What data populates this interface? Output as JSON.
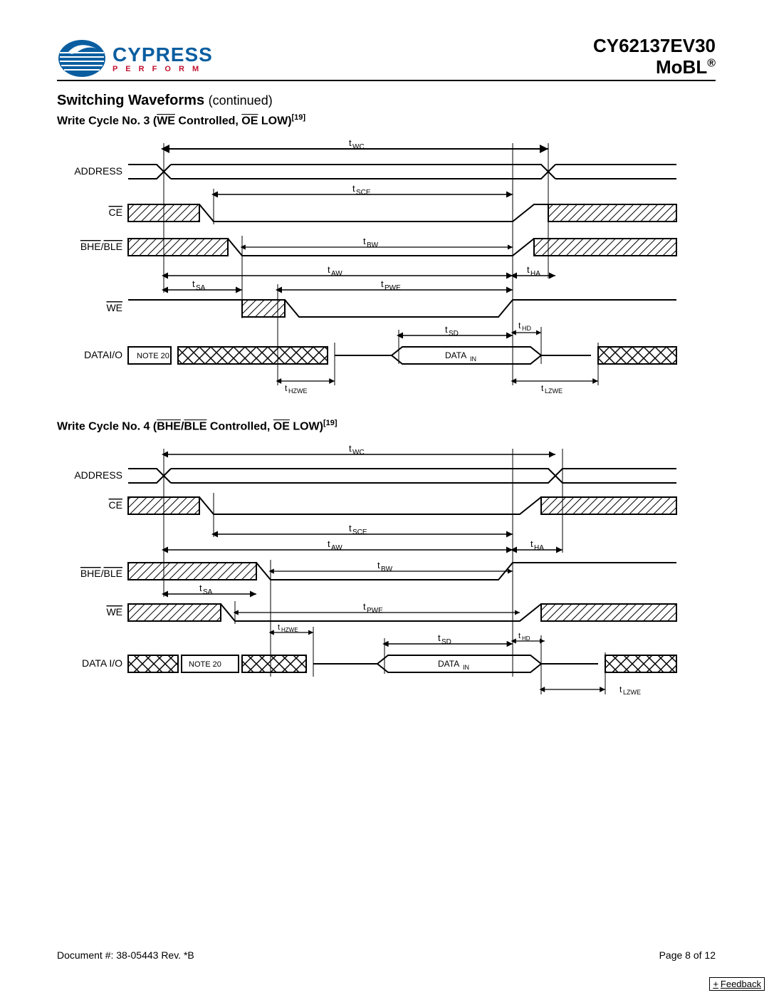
{
  "header": {
    "brand_main": "CYPRESS",
    "brand_sub": "P E R F O R M",
    "part_line1": "CY62137EV30",
    "part_line2": "MoBL"
  },
  "section": {
    "title": "Switching Waveforms",
    "continued": "(continued)"
  },
  "wf3": {
    "title_pre": "Write Cycle No. 3 (",
    "we": "WE",
    "mid": " Controlled, ",
    "oe": "OE",
    "post": " LOW)",
    "note_ref": "[19]",
    "signals": {
      "address": "ADDRESS",
      "ce": "CE",
      "bhe_ble_a": "BHE",
      "bhe_ble_b": "BLE",
      "we": "WE",
      "dataio": "DATAI/O"
    },
    "labels": {
      "twc": "tWC",
      "tsce": "tSCE",
      "tbw": "tBW",
      "taw": "tAW",
      "tha": "tHA",
      "tsa": "tSA",
      "tpwe": "tPWE",
      "tsd": "tSD",
      "thd": "tHD",
      "thzwe": "tHZWE",
      "tlzwe": "tLZWE",
      "note20": "NOTE 20",
      "datain": "DATAIN"
    }
  },
  "wf4": {
    "title_pre": "Write Cycle No. 4 (",
    "bhe": "BHE",
    "slash": "/",
    "ble": "BLE",
    "mid": " Controlled, ",
    "oe": "OE",
    "post": " LOW)",
    "note_ref": "[19]",
    "signals": {
      "address": "ADDRESS",
      "ce": "CE",
      "bhe_ble_a": "BHE",
      "bhe_ble_b": "BLE",
      "we": "WE",
      "dataio": "DATA I/O"
    },
    "labels": {
      "twc": "tWC",
      "tsce": "tSCE",
      "tbw": "tBW",
      "taw": "tAW",
      "tha": "tHA",
      "tsa": "tSA",
      "tpwe": "tPWE",
      "tsd": "tSD",
      "thd": "tHD",
      "thzwe": "tHZWE",
      "tlzwe": "tLZWE",
      "note20": "NOTE 20",
      "datain": "DATAIN"
    }
  },
  "footer": {
    "doc": "Document #: 38-05443 Rev. *B",
    "page": "Page 8 of 12",
    "feedback": "Feedback",
    "feedback_icon": "+"
  },
  "chart_data": [
    {
      "type": "timing-diagram",
      "title": "Write Cycle No. 3 (WE Controlled, OE LOW)",
      "note_ref": 19,
      "signals": [
        "ADDRESS",
        "CE",
        "BHE/BLE",
        "WE",
        "DATA I/O"
      ],
      "intervals": [
        {
          "name": "tWC",
          "from": "ADDRESS valid start",
          "to": "ADDRESS valid end"
        },
        {
          "name": "tSCE",
          "from": "CE low",
          "to": "WE high"
        },
        {
          "name": "tBW",
          "from": "BHE/BLE low",
          "to": "WE high"
        },
        {
          "name": "tAW",
          "from": "ADDRESS valid",
          "to": "WE high"
        },
        {
          "name": "tHA",
          "from": "WE high",
          "to": "ADDRESS invalid"
        },
        {
          "name": "tSA",
          "from": "ADDRESS valid",
          "to": "WE low"
        },
        {
          "name": "tPWE",
          "from": "WE low",
          "to": "WE high"
        },
        {
          "name": "tSD",
          "from": "DATA IN valid",
          "to": "WE high"
        },
        {
          "name": "tHD",
          "from": "WE high",
          "to": "DATA IN invalid"
        },
        {
          "name": "tHZWE",
          "from": "WE low",
          "to": "DATA I/O Hi-Z"
        },
        {
          "name": "tLZWE",
          "from": "WE high",
          "to": "DATA I/O driven"
        }
      ],
      "data_io_regions": [
        "NOTE 20 (driven/crosshatch)",
        "Hi-Z",
        "DATA IN",
        "Hi-Z",
        "crosshatch"
      ]
    },
    {
      "type": "timing-diagram",
      "title": "Write Cycle No. 4 (BHE/BLE Controlled, OE LOW)",
      "note_ref": 19,
      "signals": [
        "ADDRESS",
        "CE",
        "BHE/BLE",
        "WE",
        "DATA I/O"
      ],
      "intervals": [
        {
          "name": "tWC",
          "from": "ADDRESS valid start",
          "to": "ADDRESS valid end"
        },
        {
          "name": "tSCE",
          "from": "CE low",
          "to": "BHE/BLE high"
        },
        {
          "name": "tAW",
          "from": "ADDRESS valid",
          "to": "BHE/BLE high"
        },
        {
          "name": "tHA",
          "from": "BHE/BLE high",
          "to": "ADDRESS invalid"
        },
        {
          "name": "tBW",
          "from": "BHE/BLE low",
          "to": "BHE/BLE high"
        },
        {
          "name": "tSA",
          "from": "ADDRESS valid",
          "to": "BHE/BLE low"
        },
        {
          "name": "tPWE",
          "from": "WE low",
          "to": "WE high"
        },
        {
          "name": "tHZWE",
          "from": "WE low",
          "to": "DATA I/O Hi-Z"
        },
        {
          "name": "tSD",
          "from": "DATA IN valid",
          "to": "BHE/BLE high"
        },
        {
          "name": "tHD",
          "from": "BHE/BLE high",
          "to": "DATA IN invalid"
        },
        {
          "name": "tLZWE",
          "from": "BHE/BLE high",
          "to": "DATA I/O driven"
        }
      ],
      "data_io_regions": [
        "crosshatch",
        "NOTE 20",
        "crosshatch",
        "Hi-Z",
        "DATA IN",
        "Hi-Z",
        "crosshatch"
      ]
    }
  ]
}
